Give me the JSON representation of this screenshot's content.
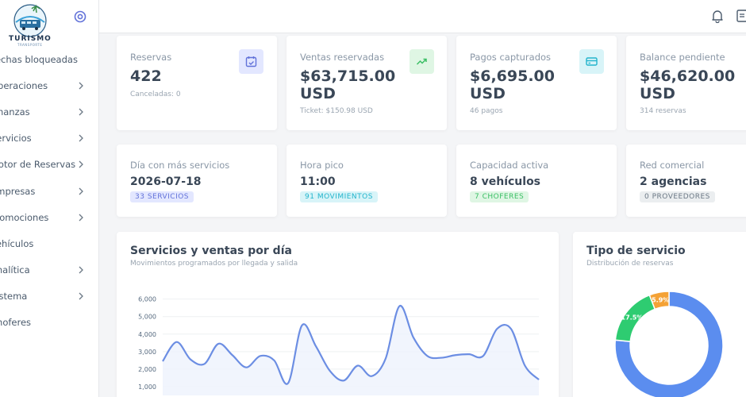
{
  "brand": {
    "name": "TURISMO",
    "tagline": "TRANSPORTE"
  },
  "sidebar": {
    "items": [
      {
        "label": "Fechas bloqueadas",
        "has_children": false
      },
      {
        "label": "Operaciones",
        "has_children": true
      },
      {
        "label": "Finanzas",
        "has_children": true
      },
      {
        "label": "Servicios",
        "has_children": true
      },
      {
        "label": "Motor de Reservas",
        "has_children": true
      },
      {
        "label": "Empresas",
        "has_children": true
      },
      {
        "label": "Promociones",
        "has_children": true
      },
      {
        "label": "Vehículos",
        "has_children": false
      },
      {
        "label": "Analítica",
        "has_children": true
      },
      {
        "label": "Sistema",
        "has_children": true
      },
      {
        "label": "Choferes",
        "has_children": false
      }
    ]
  },
  "stats": [
    {
      "label": "Reservas",
      "value_line1": "422",
      "value_line2": "",
      "sub": "Canceladas: 0",
      "icon": "calendar-check-icon",
      "icon_bg": "#e3e7ff",
      "icon_color": "#6272d9"
    },
    {
      "label": "Ventas reservadas",
      "value_line1": "$63,715.00",
      "value_line2": "USD",
      "sub": "Ticket: $150.98 USD",
      "icon": "trending-up-icon",
      "icon_bg": "#dff6e4",
      "icon_color": "#3bbf65"
    },
    {
      "label": "Pagos capturados",
      "value_line1": "$6,695.00",
      "value_line2": "USD",
      "sub": "46 pagos",
      "icon": "credit-card-icon",
      "icon_bg": "#d8f4f8",
      "icon_color": "#22b4cc"
    },
    {
      "label": "Balance pendiente",
      "value_line1": "$46,620.00",
      "value_line2": "USD",
      "sub": "314 reservas",
      "icon": "",
      "icon_bg": "",
      "icon_color": ""
    }
  ],
  "highlights": [
    {
      "label": "Día con más servicios",
      "value": "2026-07-18",
      "badge": "33 SERVICIOS",
      "badge_bg": "#e3e7ff",
      "badge_color": "#6272d9"
    },
    {
      "label": "Hora pico",
      "value": "11:00",
      "badge": "91 MOVIMIENTOS",
      "badge_bg": "#d8f4f8",
      "badge_color": "#22b4cc"
    },
    {
      "label": "Capacidad activa",
      "value": "8 vehículos",
      "badge": "7 CHOFERES",
      "badge_bg": "#dff6e4",
      "badge_color": "#3bbf65"
    },
    {
      "label": "Red comercial",
      "value": "2 agencias",
      "badge": "0 PROVEEDORES",
      "badge_bg": "#ebeef0",
      "badge_color": "#6b7885"
    }
  ],
  "line_panel": {
    "title": "Servicios y ventas por día",
    "subtitle": "Movimientos programados por llegada y salida"
  },
  "donut_panel": {
    "title": "Tipo de servicio",
    "subtitle": "Distribución de reservas"
  },
  "chart_data": [
    {
      "type": "line",
      "title": "Servicios y ventas por día",
      "subtitle": "Movimientos programados por llegada y salida",
      "ylim": [
        500,
        6300
      ],
      "y_ticks": [
        1000,
        2000,
        3000,
        4000,
        5000,
        6000
      ],
      "y_tick_labels": [
        "1,000",
        "2,000",
        "3,000",
        "4,000",
        "5,000",
        "6,000"
      ],
      "grid": true,
      "color": "#6c8ee3",
      "series": [
        {
          "values": [
            2450,
            3550,
            2550,
            2300,
            3450,
            2800,
            2100,
            2750,
            2500,
            1200,
            4500,
            3300,
            1900,
            1350,
            2200,
            1600,
            2600,
            5600,
            3800,
            2750,
            2650,
            2800,
            2850,
            2750,
            4300,
            4300,
            2200,
            1400
          ]
        }
      ]
    },
    {
      "type": "pie",
      "title": "Tipo de servicio",
      "subtitle": "Distribución de reservas",
      "slices": [
        {
          "value": 76.5,
          "label": "76.5%",
          "color": "#5b8def"
        },
        {
          "value": 17.5,
          "label": "17.5%",
          "color": "#2ecc71"
        },
        {
          "value": 5.9,
          "label": "5.9%",
          "color": "#f4a236"
        }
      ]
    }
  ]
}
